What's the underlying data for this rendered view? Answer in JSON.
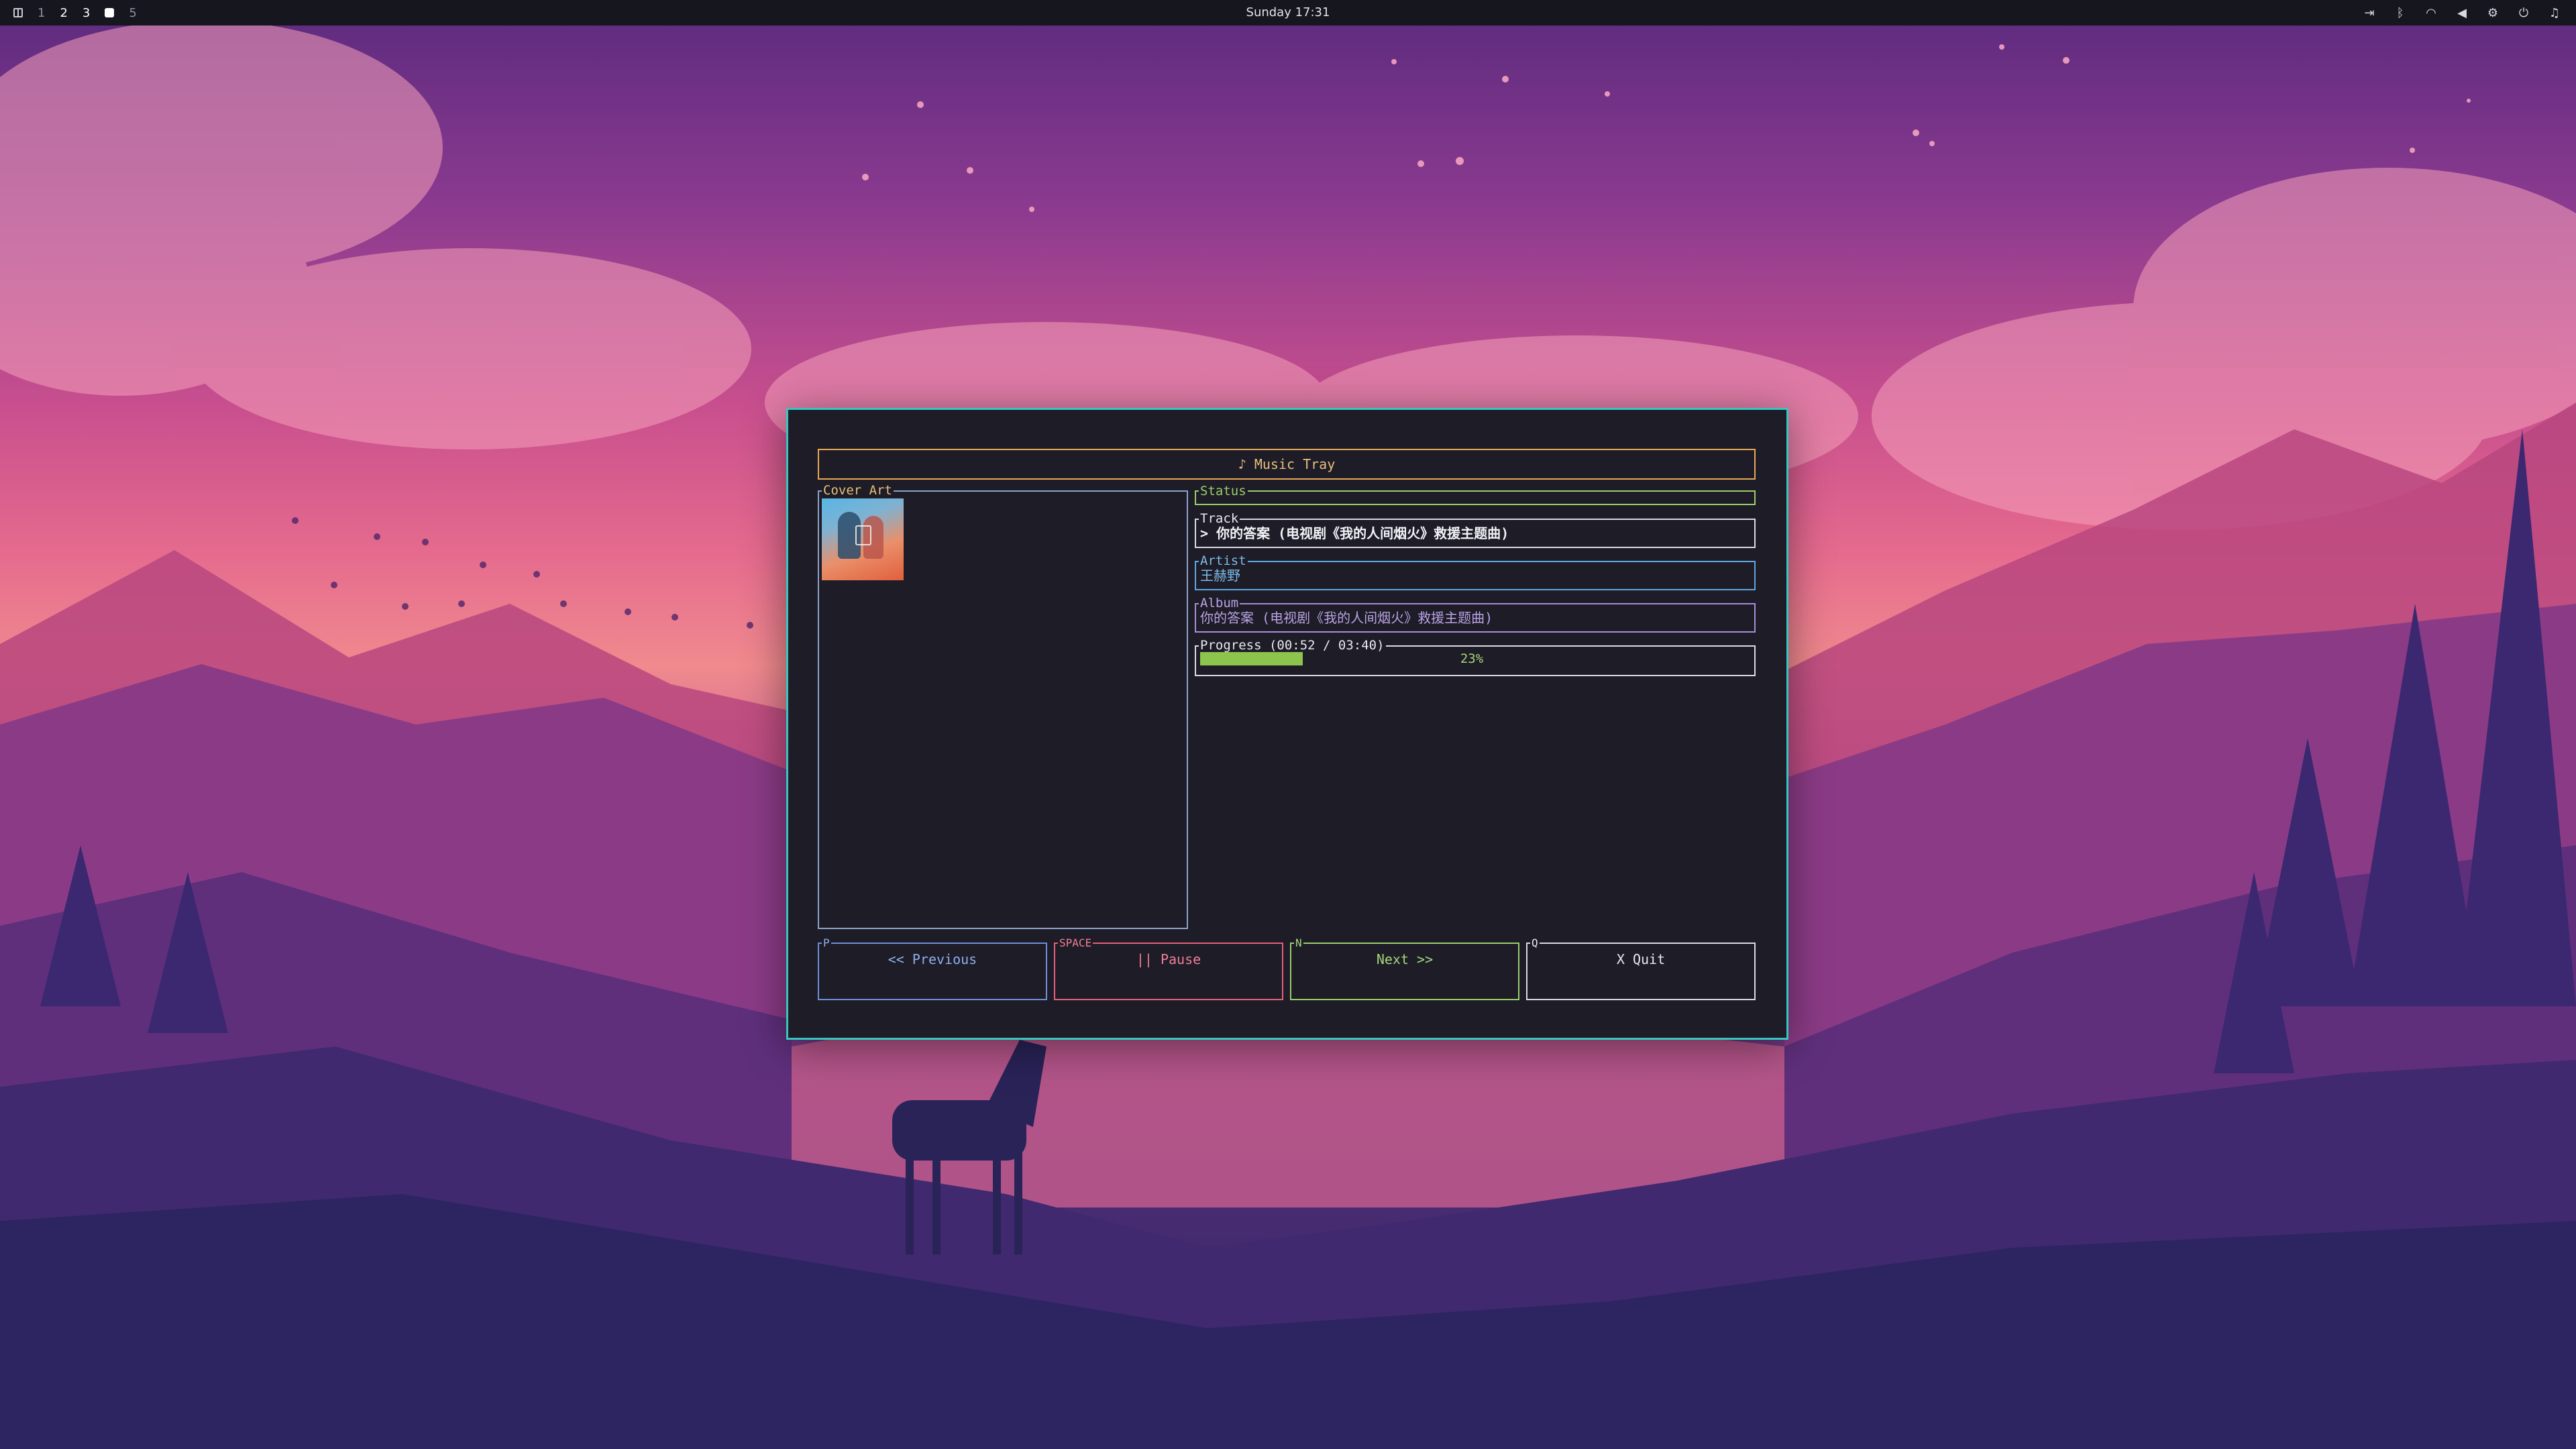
{
  "topbar": {
    "workspaces": [
      "1",
      "2",
      "3",
      "5"
    ],
    "clock": "Sunday 17:31"
  },
  "colors": {
    "window_border": "#37c6bf",
    "title_border": "#e6a956",
    "status_border": "#9bce6a",
    "artist_color": "#5ea8e3",
    "album_color": "#a98ed9",
    "progress_fill": "#8dc44e",
    "pause_color": "#e4607a"
  },
  "app": {
    "title": "♪ Music Tray",
    "cover_label": "Cover Art",
    "status_label": "Status",
    "status_value": "",
    "track_label": "Track",
    "track_value": "> 你的答案 (电视剧《我的人间烟火》救援主题曲)",
    "artist_label": "Artist",
    "artist_value": "王赫野",
    "album_label": "Album",
    "album_value": "你的答案 (电视剧《我的人间烟火》救援主题曲)",
    "progress_label": "Progress (00:52 / 03:40)",
    "progress_percent": 23,
    "progress_text": "23%"
  },
  "buttons": {
    "prev": {
      "key": "P",
      "label": "<< Previous"
    },
    "pause": {
      "key": "SPACE",
      "label": "|| Pause"
    },
    "next": {
      "key": "N",
      "label": "Next >>"
    },
    "quit": {
      "key": "Q",
      "label": "X Quit"
    }
  }
}
